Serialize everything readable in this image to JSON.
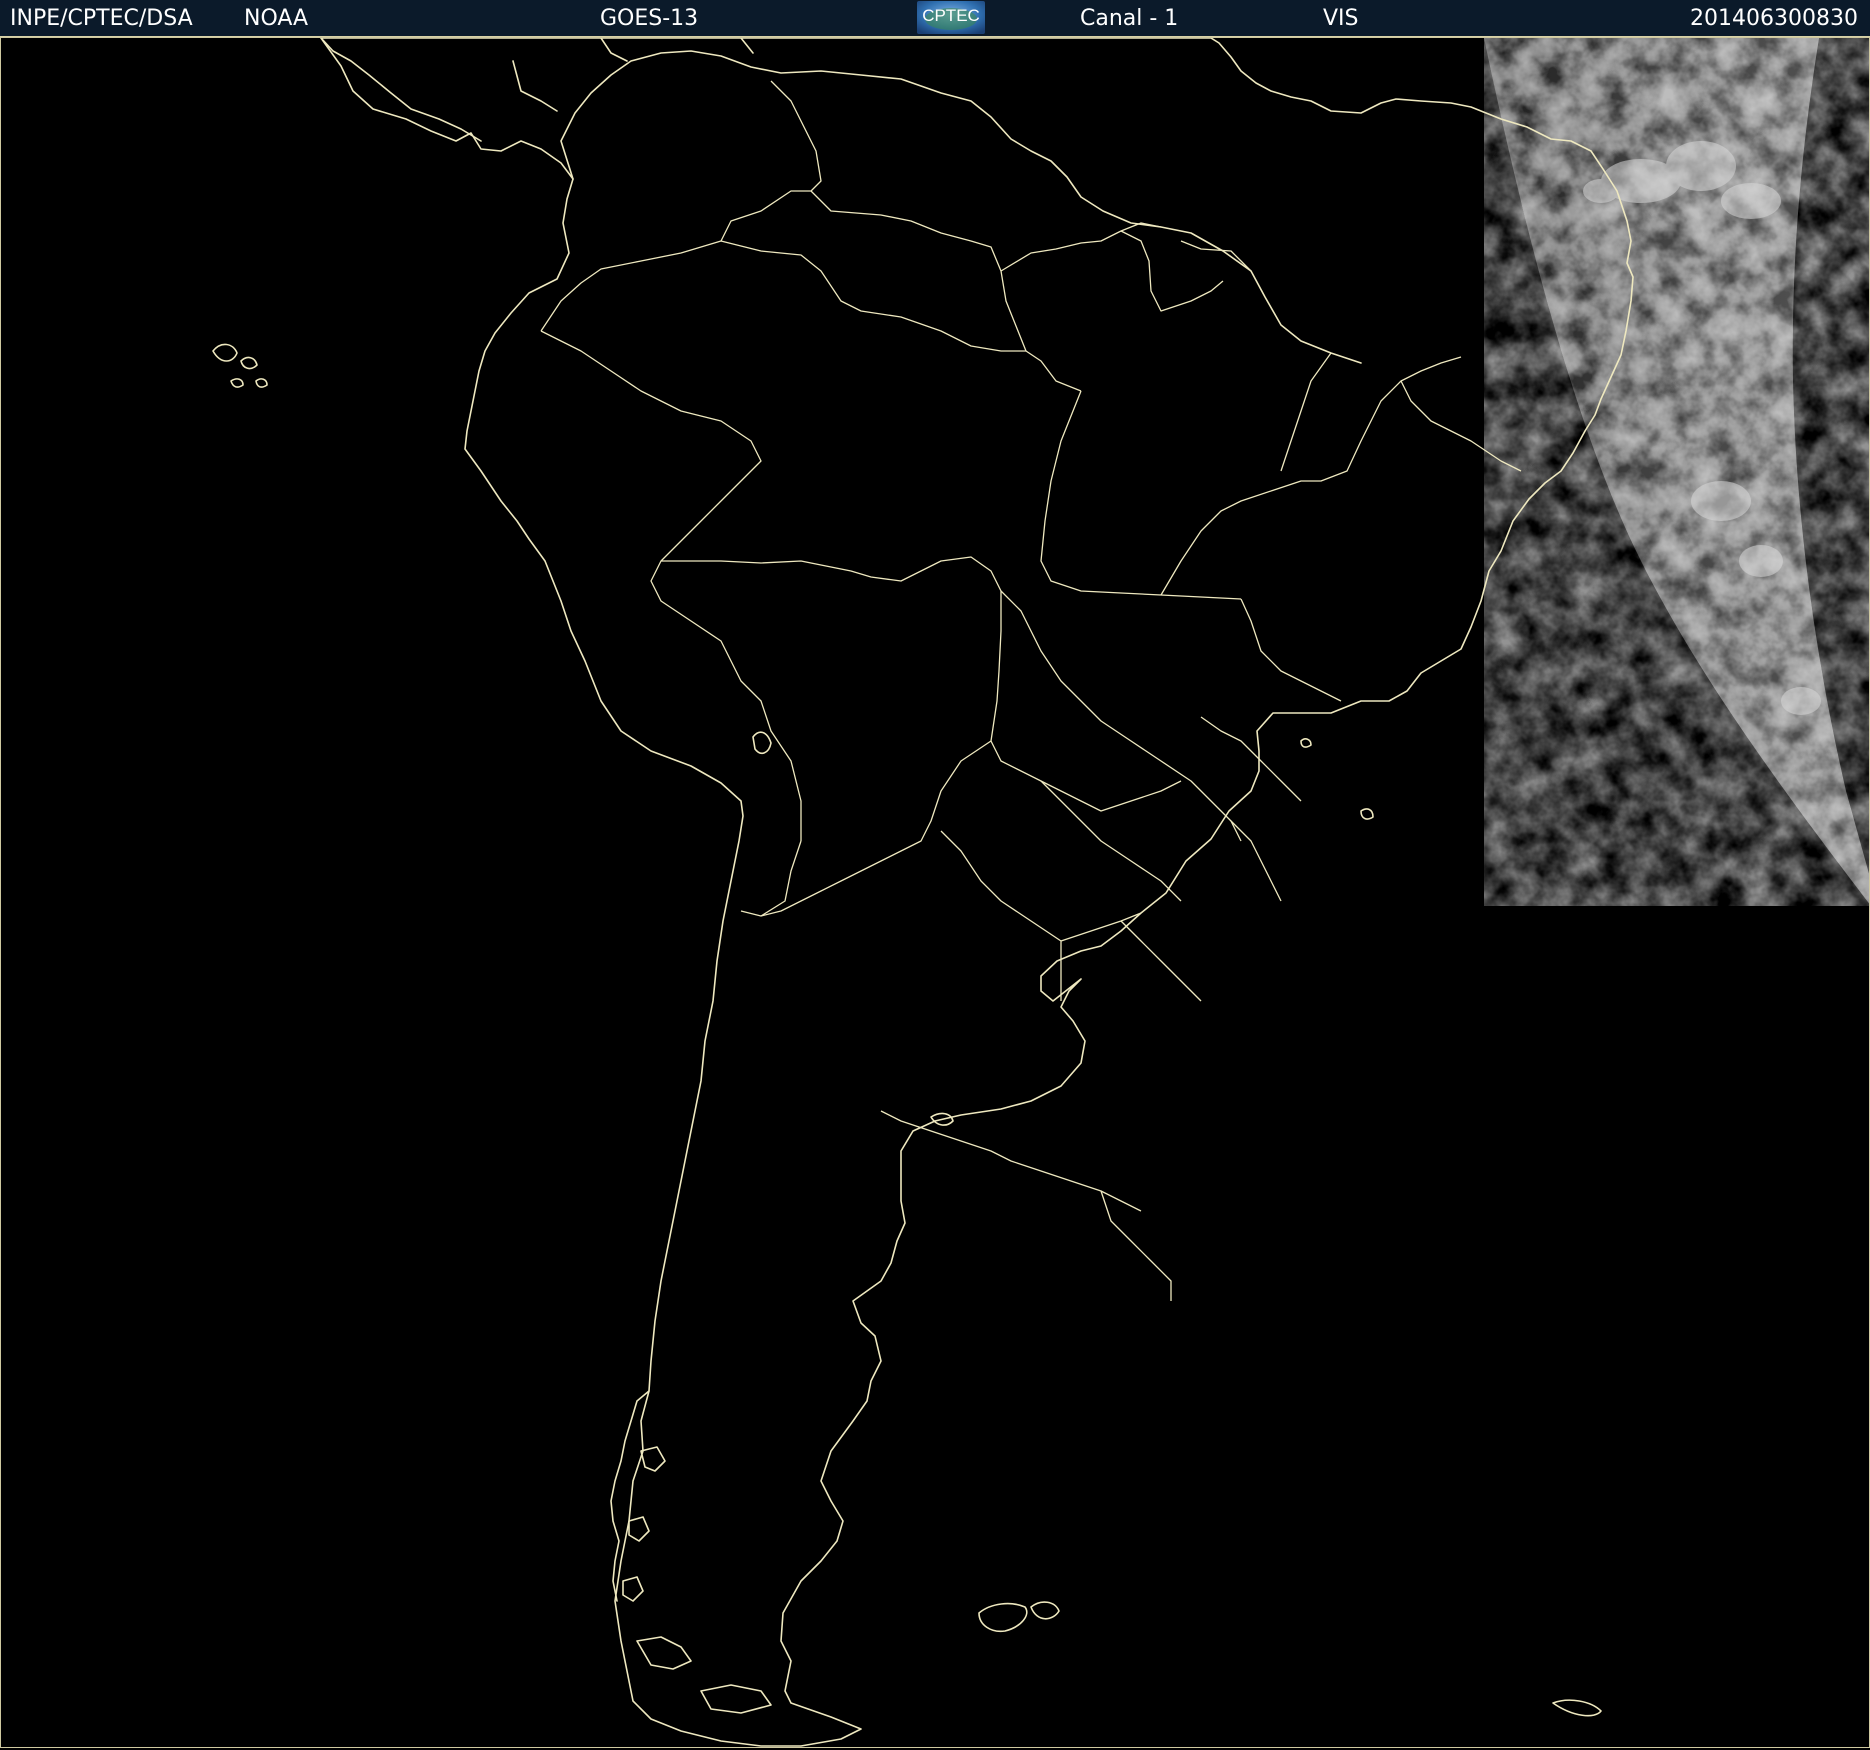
{
  "header": {
    "org": "INPE/CPTEC/DSA",
    "agency": "NOAA",
    "satellite": "GOES-13",
    "logo_text": "CPTEC",
    "channel": "Canal - 1",
    "band": "VIS",
    "timestamp": "201406300830"
  },
  "colors": {
    "background": "#000000",
    "outline": "#eee8bf",
    "header_bg": "#0b1a2a",
    "header_text": "#ffffff",
    "logo_blue": "#2f6fb0"
  },
  "icons": {
    "logo": "cptec-logo"
  },
  "image": {
    "type": "satellite-visible",
    "outlines": "continent-and-country-borders",
    "cloud_region": "east-earth-limb"
  }
}
